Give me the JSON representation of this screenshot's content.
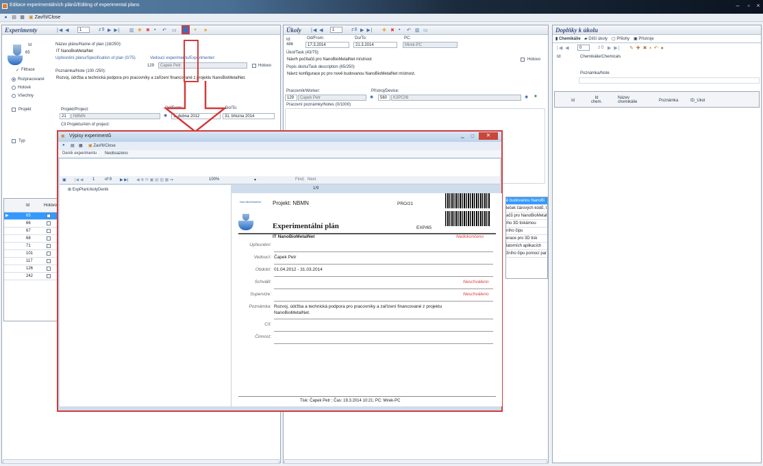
{
  "window": {
    "title": "Editace experimentálních plánů/Editing of experimental plans",
    "close_label": "Zavřít/Close"
  },
  "experimenty": {
    "title": "Experimenty",
    "nav_pos": "1",
    "nav_count": "z9",
    "id_label": "Id",
    "id_value": "65",
    "name_label": "Název plánu/Name of plan (18/250):",
    "name_value": "IT NanoBioMetalNet",
    "spec_label": "Upřesnění plánu/Specification of plan (0/75)",
    "vedouci_label": "Vedoucí experimentu/Experimenter:",
    "vedouci_id": "129",
    "vedouci_name": "Čapek Petr",
    "hotovo_label": "Hotovo",
    "note_label": "Poznámka/Note (100 /250):",
    "note_value": "Rozvoj, údržba a technická podpora pro pracovníky a zařízení financované z projektu NanoBioMetalNet.",
    "filter_label": "Filtrace",
    "filter_opts": [
      "Rozpracované",
      "Hotové",
      "Všechny"
    ],
    "projekt_chk": "Projekt",
    "typ_chk": "Typ",
    "project_label": "Projekt/Project:",
    "project_id": "21",
    "project_name": "NBMN",
    "od_label": "Od/From:",
    "od_value": "1. dubna 2012",
    "do_label": "Do/To:",
    "do_value": "31. března 2014",
    "aim_label": "Cíl Projektu/Aim of project:",
    "grid_headers": [
      "Id",
      "Hotovo"
    ],
    "grid_rows": [
      "65",
      "66",
      "67",
      "68",
      "71",
      "101",
      "117",
      "126",
      "242"
    ]
  },
  "ukoly": {
    "title": "Úkoly",
    "nav_pos": "1",
    "nav_count": "z8",
    "id_label": "Id:",
    "id_value": "486",
    "od_label": "Od/From:",
    "od_value": "17.3.2014",
    "do_label": "Do/To:",
    "do_value": "21.3.2014",
    "pc_label": "PC:",
    "pc_value": "Mirek-PC",
    "task_label": "Úkol/Task (43/75):",
    "task_value": "Návrh počítačů pro NanoBioMetalNet místnost",
    "hotovo_label": "Hotovo",
    "desc_label": "Popis úkolu/Task description (65/250)",
    "desc_value": "Návrz konfigurace pc pro nově budovanou NanoBioMetalNet místnost.",
    "worker_label": "Pracovník/Worker:",
    "worker_id": "129",
    "worker_name": "Čapek Petr",
    "device_label": "Přístroj/Device:",
    "device_id": "560",
    "device_name": "K3PC06",
    "notes_label": "Pracovní poznámky/Notes (0/1000)",
    "list_items": [
      "ě budovanou NanoBi",
      "leček čárových kódů, t",
      "ačů pro NanoBioMetalN",
      "ího 3D tiskárnou",
      "ního čipu",
      "erace pro 3D tisk",
      "latorních aplikacích",
      "žního čipu pomocí par"
    ]
  },
  "doplnky": {
    "title": "Doplňky k úkolu",
    "tabs": [
      "Chemikálie",
      "Dílčí úkoly",
      "Přílohy",
      "Přístroje"
    ],
    "nav_pos": "0",
    "nav_count": "z0",
    "id_label": "Id:",
    "chem_label": "Chemikálie/Chemicals",
    "note_label": "Poznámka/Note",
    "grid_headers": [
      "Id",
      "Id chem.",
      "Název chemikálie",
      "Poznámka",
      "ID_Ukol"
    ]
  },
  "dialog": {
    "title": "Výpisy experimentů",
    "close_label": "Zavřít/Close",
    "tabs": [
      "Deník experimentu",
      "Neobsazeno"
    ],
    "page_pos": "1",
    "page_count": "of 9",
    "zoom": "100%",
    "find": "Find",
    "next": "Next",
    "page_indicator": "1/9",
    "tree_item": "ExpPlanUkolyDenik"
  },
  "report": {
    "logo_text": "NanoBioMetalNet",
    "project_line": "Projekt: NBMN",
    "pro_code": "PRO/21",
    "heading": "Experimentální plán",
    "exp_code": "EXP/65",
    "plan_name": "IT NanoBioMetalNet",
    "status": "Nedokončeno",
    "rows": [
      {
        "label": "Upřesnění:",
        "value": ""
      },
      {
        "label": "Vedoucí:",
        "value": "Čapek Petr"
      },
      {
        "label": "Období:",
        "value": "01.04.2012  -  31.03.2014"
      },
      {
        "label": "Schválil:",
        "value": "",
        "red": "Neschváleno"
      },
      {
        "label": "Supervize:",
        "value": "",
        "red": "Neschváleno"
      },
      {
        "label": "Poznámka:",
        "value": "Rozvoj, údržba a technická podpora pro pracovníky a zařízení financované z projektu",
        "value2": "NanoBioMetalNet."
      },
      {
        "label": "Cíl:",
        "value": ""
      },
      {
        "label": "Činnost:",
        "value": ""
      }
    ],
    "footer": "Tisk: Čapek Petr ; Čas: 19.3.2014  10:21; PC: Mirek-PC"
  }
}
